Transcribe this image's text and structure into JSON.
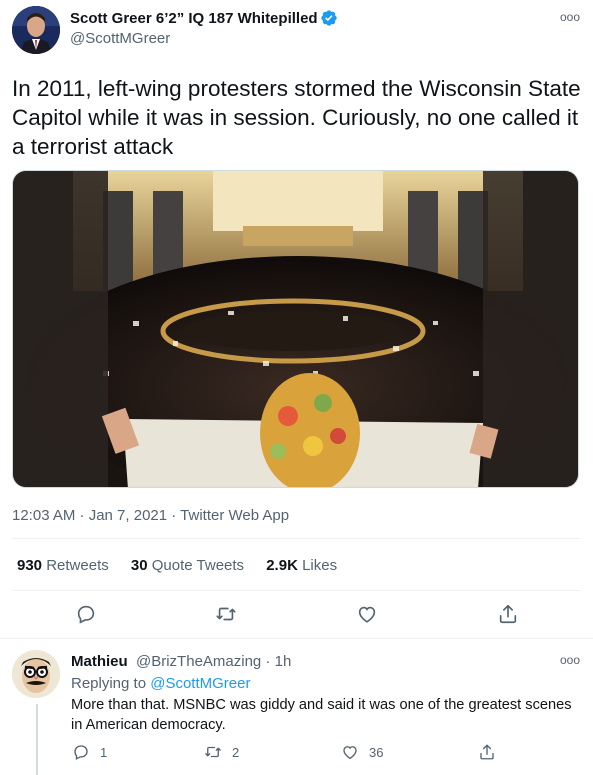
{
  "tweet": {
    "author_name": "Scott Greer 6’2” IQ 187 Whitepilled",
    "author_handle": "@ScottMGreer",
    "text": "In 2011, left-wing protesters stormed the Wisconsin State Capitol while it was in session. Curiously, no one called it a terrorist attack",
    "timestamp": "12:03 AM · Jan 7, 2021 · Twitter Web App",
    "stats": {
      "retweets_count": "930",
      "retweets_label": "Retweets",
      "quotes_count": "30",
      "quotes_label": "Quote Tweets",
      "likes_count": "2.9K",
      "likes_label": "Likes"
    },
    "more_glyph": "ooo"
  },
  "reply": {
    "author_name": "Mathieu",
    "author_handle": "@BrizTheAmazing · 1h",
    "replying_prefix": "Replying to",
    "replying_to": "@ScottMGreer",
    "text": "More than that. MSNBC was giddy and said it was one of the greatest scenes in American democracy.",
    "reply_count": "1",
    "retweet_count": "2",
    "like_count": "36",
    "more_glyph": "ooo"
  },
  "colors": {
    "accent": "#1d9bf0",
    "secondary_text": "#536471",
    "divider": "#eff3f4"
  },
  "icons": [
    "verified-badge-icon",
    "reply-icon",
    "retweet-icon",
    "like-icon",
    "share-icon",
    "more-icon"
  ]
}
